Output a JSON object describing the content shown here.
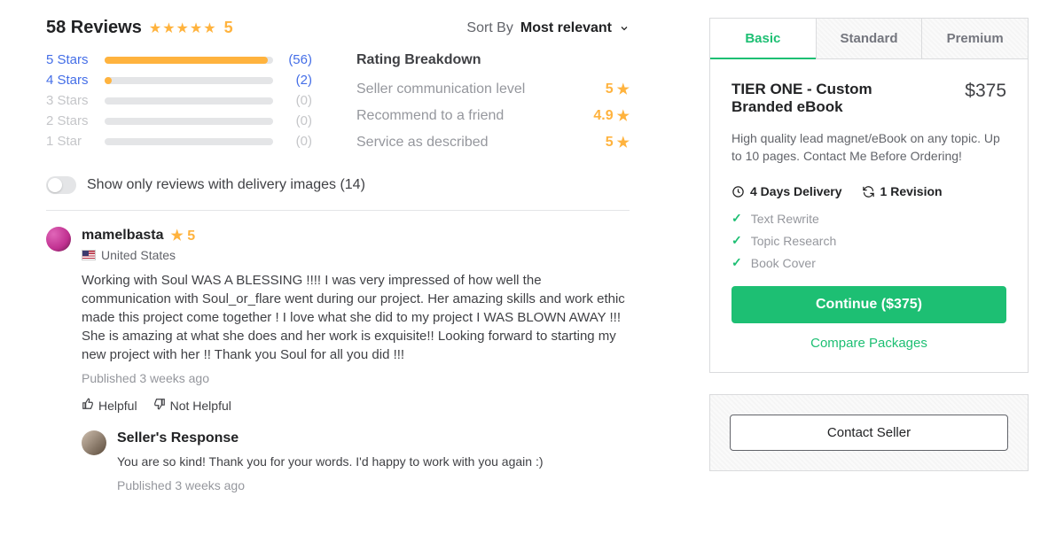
{
  "reviews": {
    "count_label": "58 Reviews",
    "overall_rating": "5",
    "sort_label": "Sort By",
    "sort_value": "Most relevant",
    "distribution": [
      {
        "label": "5 Stars",
        "count": "(56)",
        "pct": 97,
        "active": true
      },
      {
        "label": "4 Stars",
        "count": "(2)",
        "pct": 4,
        "active": true
      },
      {
        "label": "3 Stars",
        "count": "(0)",
        "pct": 0,
        "active": false
      },
      {
        "label": "2 Stars",
        "count": "(0)",
        "pct": 0,
        "active": false
      },
      {
        "label": "1 Star",
        "count": "(0)",
        "pct": 0,
        "active": false
      }
    ],
    "breakdown_title": "Rating Breakdown",
    "breakdown": [
      {
        "label": "Seller communication level",
        "value": "5"
      },
      {
        "label": "Recommend to a friend",
        "value": "4.9"
      },
      {
        "label": "Service as described",
        "value": "5"
      }
    ],
    "toggle_label": "Show only reviews with delivery images (14)",
    "review": {
      "name": "mamelbasta",
      "rating": "5",
      "country": "United States",
      "text": "Working with Soul WAS A BLESSING !!!! I was very impressed of how well the communication with Soul_or_flare went during our project. Her amazing skills and work ethic made this project come together ! I love what she did to my project I WAS BLOWN AWAY !!! She is amazing at what she does and her work is exquisite!! Looking forward to starting my new project with her !! Thank you Soul for all you did !!!",
      "published": "Published 3 weeks ago",
      "helpful": "Helpful",
      "not_helpful": "Not Helpful"
    },
    "seller_response": {
      "title": "Seller's Response",
      "text": "You are so kind! Thank you for your words. I'd happy to work with you again :)",
      "published": "Published 3 weeks ago"
    }
  },
  "package": {
    "tabs": {
      "basic": "Basic",
      "standard": "Standard",
      "premium": "Premium",
      "active": "basic"
    },
    "title": "TIER ONE - Custom Branded eBook",
    "price": "$375",
    "description": "High quality lead magnet/eBook on any topic. Up to 10 pages. Contact Me Before Ordering!",
    "delivery": "4 Days Delivery",
    "revisions": "1 Revision",
    "features": [
      "Text Rewrite",
      "Topic Research",
      "Book Cover"
    ],
    "continue": "Continue ($375)",
    "compare": "Compare Packages",
    "contact": "Contact Seller"
  }
}
